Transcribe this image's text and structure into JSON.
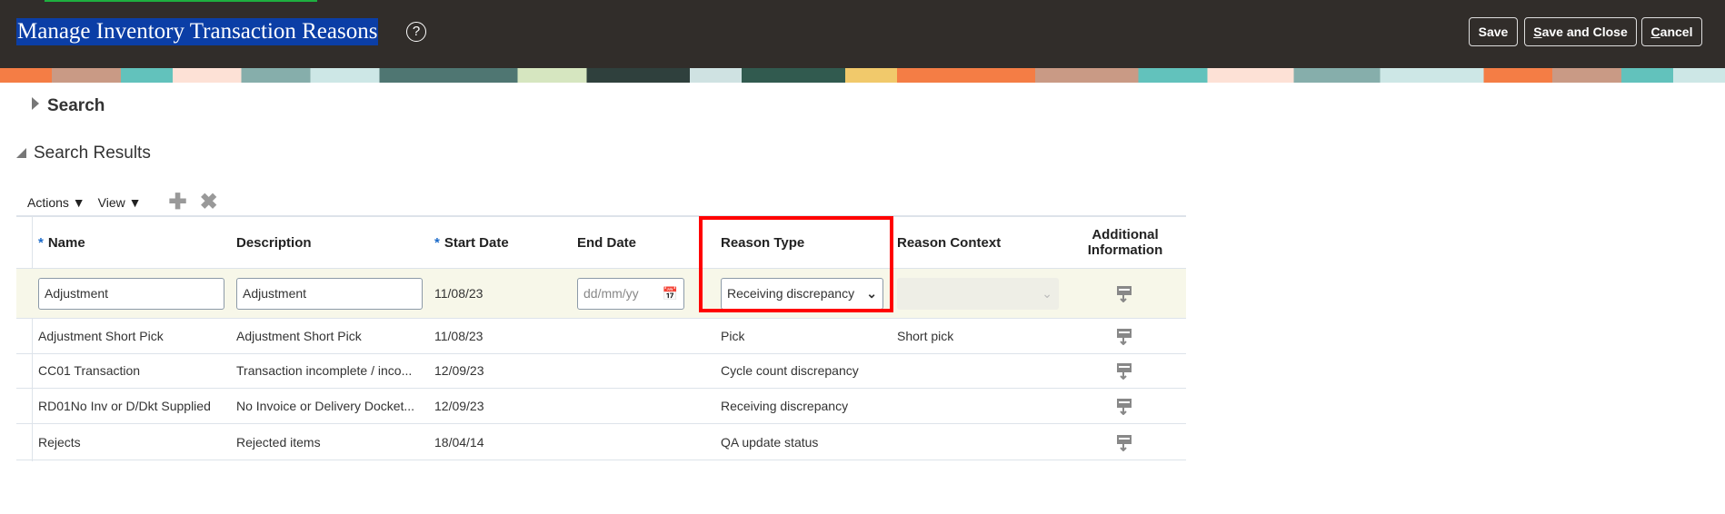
{
  "header": {
    "title": "Manage Inventory Transaction Reasons",
    "buttons": {
      "save": "Save",
      "save_close_u": "S",
      "save_close_rest": "ave and Close",
      "cancel_u": "C",
      "cancel_rest": "ancel"
    }
  },
  "search": {
    "label": "Search"
  },
  "results": {
    "label": "Search Results",
    "toolbar": {
      "actions": "Actions ▼",
      "view": "View ▼",
      "add": "✚",
      "delete": "✖"
    }
  },
  "table": {
    "columns": [
      "Name",
      "Description",
      "Start Date",
      "End Date",
      "Reason Type",
      "Reason Context",
      "Additional",
      "Information"
    ],
    "required_marker": "*",
    "edit_row": {
      "name": "Adjustment",
      "description": "Adjustment",
      "start_date": "11/08/23",
      "end_date_placeholder": "dd/mm/yy",
      "reason_type": "Receiving discrepancy",
      "reason_context": ""
    },
    "rows": [
      {
        "name": "Adjustment Short Pick",
        "description": "Adjustment Short Pick",
        "start_date": "11/08/23",
        "end_date": "",
        "reason_type": "Pick",
        "reason_context": "Short pick"
      },
      {
        "name": "CC01 Transaction",
        "description": "Transaction incomplete / inco...",
        "start_date": "12/09/23",
        "end_date": "",
        "reason_type": "Cycle count discrepancy",
        "reason_context": ""
      },
      {
        "name": "RD01No Inv or D/Dkt Supplied",
        "description": "No Invoice or Delivery Docket...",
        "start_date": "12/09/23",
        "end_date": "",
        "reason_type": "Receiving discrepancy",
        "reason_context": ""
      },
      {
        "name": "Rejects",
        "description": "Rejected items",
        "start_date": "18/04/14",
        "end_date": "",
        "reason_type": "QA update status",
        "reason_context": ""
      }
    ]
  }
}
